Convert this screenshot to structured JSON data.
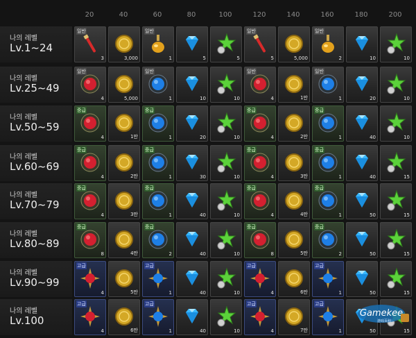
{
  "columns": [
    "20",
    "40",
    "60",
    "80",
    "100",
    "120",
    "140",
    "160",
    "180",
    "200"
  ],
  "level_prefix": "나의 레벨",
  "grade_labels": {
    "common": "일반",
    "mid": "중급",
    "high": "고급"
  },
  "colors": {
    "gold": "#d4a826",
    "red": "#d42030",
    "blue": "#1e7fe6",
    "green": "#5bd13a",
    "diamond": "#38b7ff"
  },
  "rows": [
    {
      "level": "Lv.1~24",
      "items": [
        {
          "icon": "red-potion-icon",
          "grade": "common",
          "qty": "3"
        },
        {
          "icon": "gold-coin-icon",
          "grade": "",
          "qty": "3,000"
        },
        {
          "icon": "orange-potion-icon",
          "grade": "common",
          "qty": "1"
        },
        {
          "icon": "blue-diamond-icon",
          "grade": "",
          "qty": "5"
        },
        {
          "icon": "green-star-icon",
          "grade": "",
          "qty": "5"
        },
        {
          "icon": "red-potion-icon",
          "grade": "common",
          "qty": "5"
        },
        {
          "icon": "gold-coin-icon",
          "grade": "",
          "qty": "5,000"
        },
        {
          "icon": "orange-potion-icon",
          "grade": "common",
          "qty": "2"
        },
        {
          "icon": "blue-diamond-icon",
          "grade": "",
          "qty": "10"
        },
        {
          "icon": "green-star-icon",
          "grade": "",
          "qty": "10"
        }
      ]
    },
    {
      "level": "Lv.25~49",
      "items": [
        {
          "icon": "red-gem-icon",
          "grade": "common",
          "qty": "4"
        },
        {
          "icon": "gold-coin-icon",
          "grade": "",
          "qty": "5,000"
        },
        {
          "icon": "blue-gem-icon",
          "grade": "common",
          "qty": "1"
        },
        {
          "icon": "blue-diamond-icon",
          "grade": "",
          "qty": "10"
        },
        {
          "icon": "green-star-icon",
          "grade": "",
          "qty": "10"
        },
        {
          "icon": "red-gem-icon",
          "grade": "common",
          "qty": "4"
        },
        {
          "icon": "gold-coin-icon",
          "grade": "",
          "qty": "1만"
        },
        {
          "icon": "blue-gem-icon",
          "grade": "common",
          "qty": "1"
        },
        {
          "icon": "blue-diamond-icon",
          "grade": "",
          "qty": "20"
        },
        {
          "icon": "green-star-icon",
          "grade": "",
          "qty": "10"
        }
      ]
    },
    {
      "level": "Lv.50~59",
      "items": [
        {
          "icon": "red-gem-icon",
          "grade": "mid",
          "qty": "4"
        },
        {
          "icon": "gold-coin-icon",
          "grade": "",
          "qty": "1만"
        },
        {
          "icon": "blue-gem-icon",
          "grade": "mid",
          "qty": "1"
        },
        {
          "icon": "blue-diamond-icon",
          "grade": "",
          "qty": "20"
        },
        {
          "icon": "green-star-icon",
          "grade": "",
          "qty": "10"
        },
        {
          "icon": "red-gem-icon",
          "grade": "mid",
          "qty": "4"
        },
        {
          "icon": "gold-coin-icon",
          "grade": "",
          "qty": "2만"
        },
        {
          "icon": "blue-gem-icon",
          "grade": "mid",
          "qty": "1"
        },
        {
          "icon": "blue-diamond-icon",
          "grade": "",
          "qty": "40"
        },
        {
          "icon": "green-star-icon",
          "grade": "",
          "qty": "10"
        }
      ]
    },
    {
      "level": "Lv.60~69",
      "items": [
        {
          "icon": "red-gem-icon",
          "grade": "mid",
          "qty": "4"
        },
        {
          "icon": "gold-coin-icon",
          "grade": "",
          "qty": "2만"
        },
        {
          "icon": "blue-gem-icon",
          "grade": "mid",
          "qty": "1"
        },
        {
          "icon": "blue-diamond-icon",
          "grade": "",
          "qty": "30"
        },
        {
          "icon": "green-star-icon",
          "grade": "",
          "qty": "10"
        },
        {
          "icon": "red-gem-icon",
          "grade": "mid",
          "qty": "4"
        },
        {
          "icon": "gold-coin-icon",
          "grade": "",
          "qty": "3만"
        },
        {
          "icon": "blue-gem-icon",
          "grade": "mid",
          "qty": "1"
        },
        {
          "icon": "blue-diamond-icon",
          "grade": "",
          "qty": "40"
        },
        {
          "icon": "green-star-icon",
          "grade": "",
          "qty": "15"
        }
      ]
    },
    {
      "level": "Lv.70~79",
      "items": [
        {
          "icon": "red-gem-icon",
          "grade": "mid",
          "qty": "4"
        },
        {
          "icon": "gold-coin-icon",
          "grade": "",
          "qty": "3만"
        },
        {
          "icon": "blue-gem-icon",
          "grade": "mid",
          "qty": "1"
        },
        {
          "icon": "blue-diamond-icon",
          "grade": "",
          "qty": "40"
        },
        {
          "icon": "green-star-icon",
          "grade": "",
          "qty": "10"
        },
        {
          "icon": "red-gem-icon",
          "grade": "mid",
          "qty": "4"
        },
        {
          "icon": "gold-coin-icon",
          "grade": "",
          "qty": "4만"
        },
        {
          "icon": "blue-gem-icon",
          "grade": "mid",
          "qty": "1"
        },
        {
          "icon": "blue-diamond-icon",
          "grade": "",
          "qty": "50"
        },
        {
          "icon": "green-star-icon",
          "grade": "",
          "qty": "15"
        }
      ]
    },
    {
      "level": "Lv.80~89",
      "items": [
        {
          "icon": "red-gem-icon",
          "grade": "mid",
          "qty": "8"
        },
        {
          "icon": "gold-coin-icon",
          "grade": "",
          "qty": "4만"
        },
        {
          "icon": "blue-gem-icon",
          "grade": "mid",
          "qty": "2"
        },
        {
          "icon": "blue-diamond-icon",
          "grade": "",
          "qty": "40"
        },
        {
          "icon": "green-star-icon",
          "grade": "",
          "qty": "10"
        },
        {
          "icon": "red-gem-icon",
          "grade": "mid",
          "qty": "8"
        },
        {
          "icon": "gold-coin-icon",
          "grade": "",
          "qty": "5만"
        },
        {
          "icon": "blue-gem-icon",
          "grade": "mid",
          "qty": "2"
        },
        {
          "icon": "blue-diamond-icon",
          "grade": "",
          "qty": "50"
        },
        {
          "icon": "green-star-icon",
          "grade": "",
          "qty": "15"
        }
      ]
    },
    {
      "level": "Lv.90~99",
      "items": [
        {
          "icon": "red-orb-icon",
          "grade": "high",
          "qty": "4"
        },
        {
          "icon": "gold-coin-icon",
          "grade": "",
          "qty": "5만"
        },
        {
          "icon": "blue-orb-icon",
          "grade": "high",
          "qty": "1"
        },
        {
          "icon": "blue-diamond-icon",
          "grade": "",
          "qty": "40"
        },
        {
          "icon": "green-star-icon",
          "grade": "",
          "qty": "10"
        },
        {
          "icon": "red-orb-icon",
          "grade": "high",
          "qty": "4"
        },
        {
          "icon": "gold-coin-icon",
          "grade": "",
          "qty": "6만"
        },
        {
          "icon": "blue-orb-icon",
          "grade": "high",
          "qty": "1"
        },
        {
          "icon": "blue-diamond-icon",
          "grade": "",
          "qty": "50"
        },
        {
          "icon": "green-star-icon",
          "grade": "",
          "qty": "15"
        }
      ]
    },
    {
      "level": "Lv.100",
      "items": [
        {
          "icon": "red-orb-icon",
          "grade": "high",
          "qty": "4"
        },
        {
          "icon": "gold-coin-icon",
          "grade": "",
          "qty": "6만"
        },
        {
          "icon": "blue-orb-icon",
          "grade": "high",
          "qty": "1"
        },
        {
          "icon": "blue-diamond-icon",
          "grade": "",
          "qty": "40"
        },
        {
          "icon": "green-star-icon",
          "grade": "",
          "qty": "10"
        },
        {
          "icon": "red-orb-icon",
          "grade": "high",
          "qty": "4"
        },
        {
          "icon": "gold-coin-icon",
          "grade": "",
          "qty": "7만"
        },
        {
          "icon": "blue-orb-icon",
          "grade": "high",
          "qty": "1"
        },
        {
          "icon": "blue-diamond-icon",
          "grade": "",
          "qty": "50"
        },
        {
          "icon": "green-star-icon",
          "grade": "",
          "qty": "15"
        }
      ]
    }
  ],
  "watermark": {
    "line1": "Gamekee",
    "line2": "游戏百科"
  }
}
